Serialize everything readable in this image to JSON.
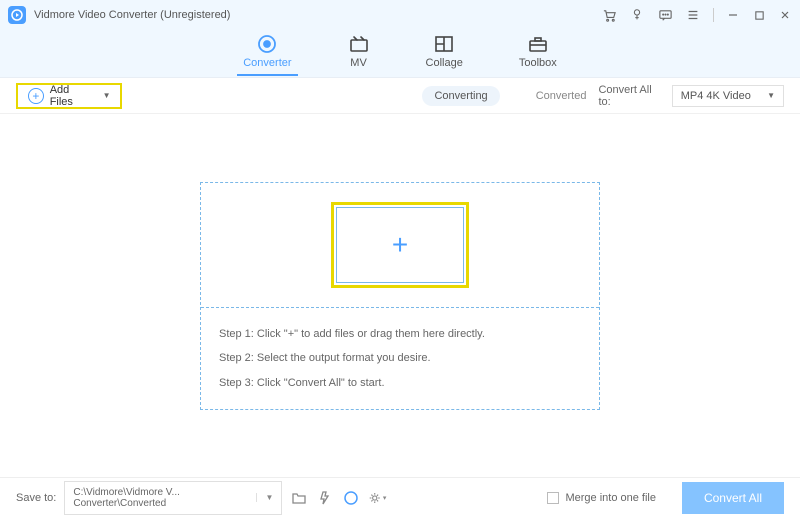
{
  "titlebar": {
    "app_title": "Vidmore Video Converter (Unregistered)"
  },
  "tabs": {
    "converter": "Converter",
    "mv": "MV",
    "collage": "Collage",
    "toolbox": "Toolbox"
  },
  "toolbar": {
    "add_files": "Add Files",
    "converting": "Converting",
    "converted": "Converted",
    "convert_all_to": "Convert All to:",
    "format": "MP4 4K Video"
  },
  "dropzone": {
    "step1": "Step 1: Click \"+\" to add files or drag them here directly.",
    "step2": "Step 2: Select the output format you desire.",
    "step3": "Step 3: Click \"Convert All\" to start."
  },
  "footer": {
    "save_to": "Save to:",
    "path": "C:\\Vidmore\\Vidmore V... Converter\\Converted",
    "merge": "Merge into one file",
    "convert_all": "Convert All"
  }
}
